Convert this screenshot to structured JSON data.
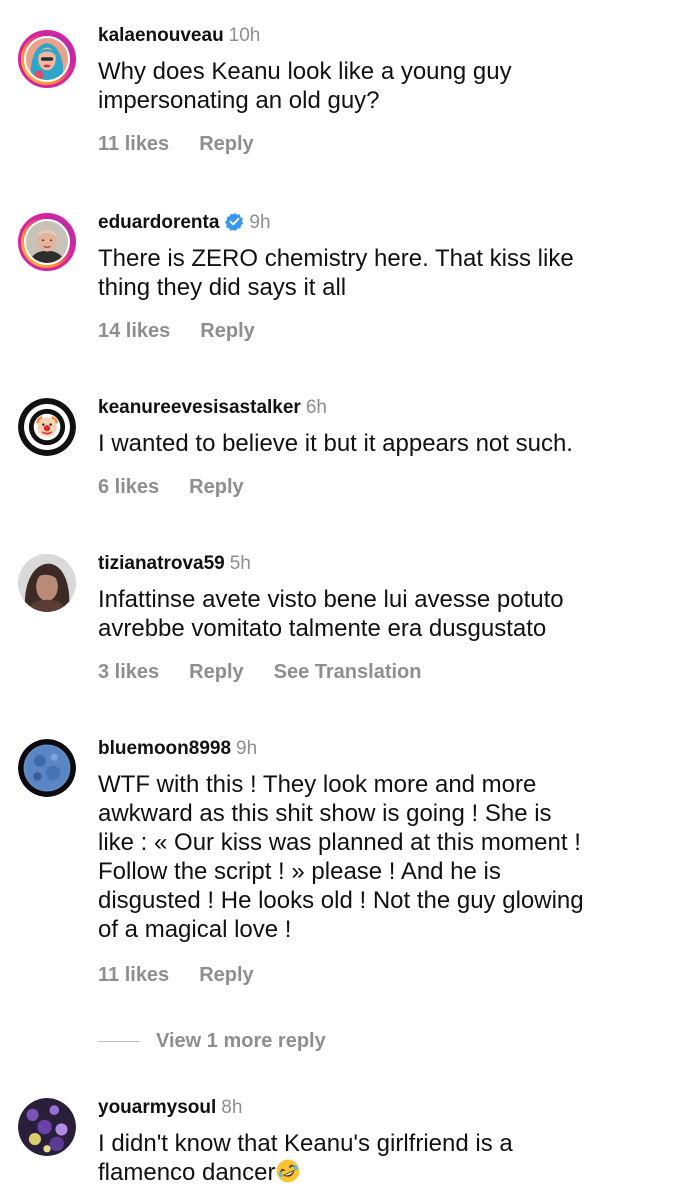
{
  "comments": [
    {
      "username": "kalaenouveau",
      "time": "10h",
      "text": "Why does Keanu look like a young guy\nimpersonating an old guy?",
      "likes": "11 likes",
      "reply": "Reply",
      "avatar_icon": "woman-portrait-blue-hair-avatar"
    },
    {
      "username": "eduardorenta",
      "verified": true,
      "time": "9h",
      "text": "There is ZERO chemistry here. That kiss like\nthing they did says it all",
      "likes": "14 likes",
      "reply": "Reply",
      "avatar_icon": "man-portrait-avatar"
    },
    {
      "username": "keanureevesisastalker",
      "time": "6h",
      "text": "I wanted to believe it but it appears not such.",
      "likes": "6 likes",
      "reply": "Reply",
      "avatar_icon": "clown-target-avatar"
    },
    {
      "username": "tizianatrova59",
      "time": "5h",
      "text": "Infattinse avete visto bene lui avesse potuto\navrebbe vomitato talmente era dusgustato",
      "likes": "3 likes",
      "reply": "Reply",
      "see_translation": "See Translation",
      "avatar_icon": "woman-portrait-avatar"
    },
    {
      "username": "bluemoon8998",
      "time": "9h",
      "text": "WTF with this ! They look more and more\nawkward as this shit show is going ! She is\nlike : « Our kiss was planned at this moment !\nFollow the script ! » please ! And he is\ndisgusted ! He looks old ! Not the guy glowing\nof a magical love !",
      "likes": "11 likes",
      "reply": "Reply",
      "view_more": "View 1 more reply",
      "avatar_icon": "blue-moon-avatar"
    },
    {
      "username": "youarmysoul",
      "time": "8h",
      "text": "I didn't know that Keanu's girlfriend is a\nflamenco dancer",
      "emoji": "rolling-on-floor-laughing-emoji",
      "avatar_icon": "purple-flowers-avatar"
    }
  ],
  "colors": {
    "text": "#111111",
    "muted": "#8e8e8e",
    "verified": "#3897f0",
    "story_ring": "#d6249f"
  }
}
